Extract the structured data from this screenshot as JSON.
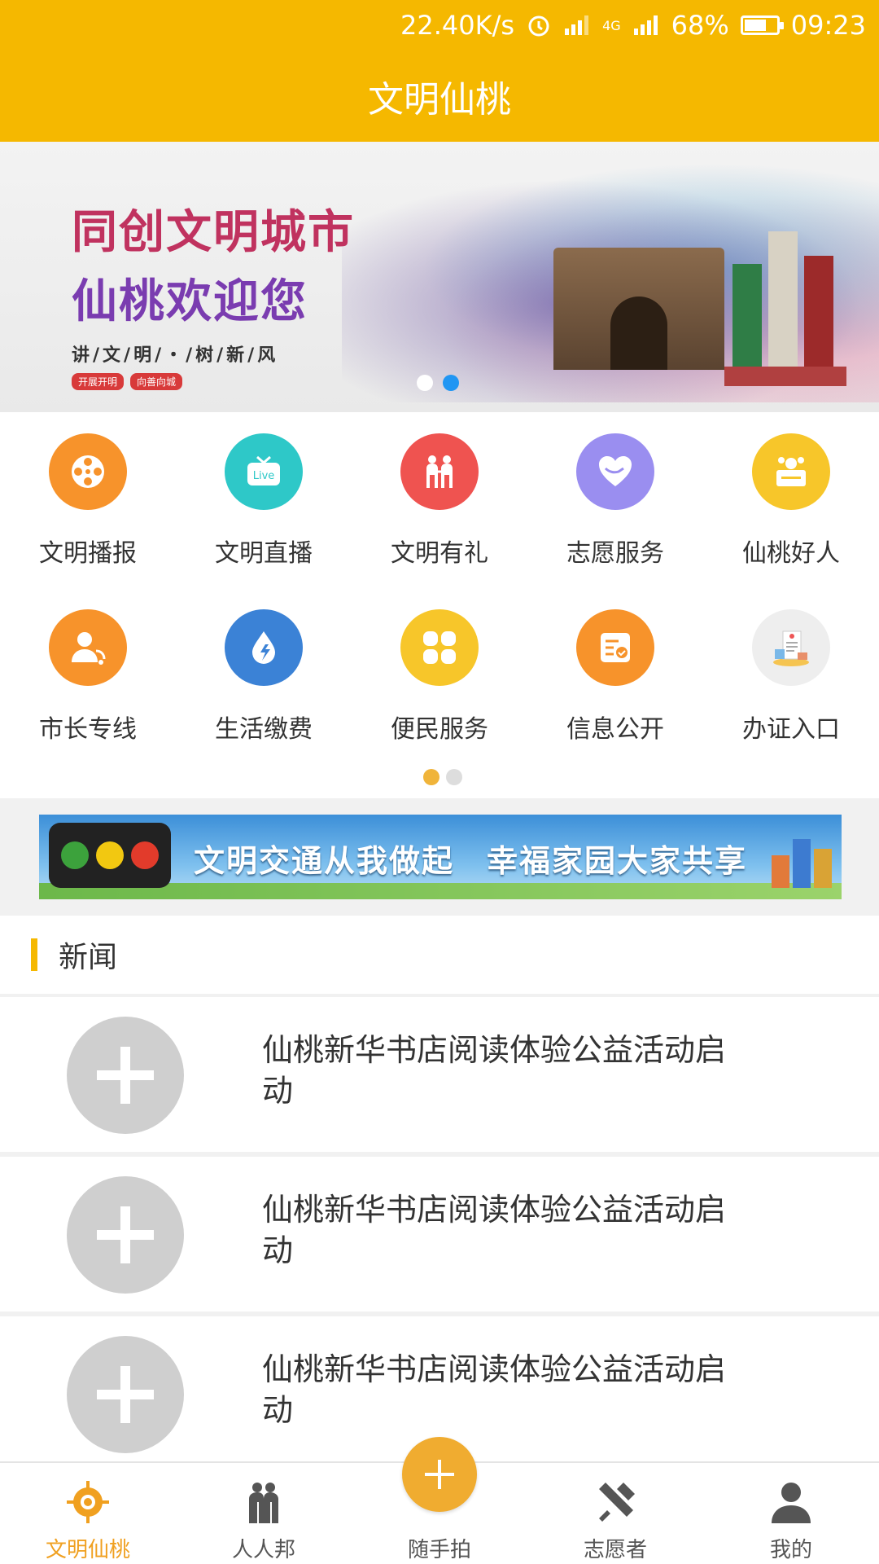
{
  "status": {
    "speed": "22.40K/s",
    "network": "4G",
    "battery": "68%",
    "battery_level": 0.68,
    "time": "09:23"
  },
  "header": {
    "title": "文明仙桃"
  },
  "banner": {
    "line1": "同创文明城市",
    "line2": "仙桃欢迎您",
    "line3": "讲/文/明/・/树/新/风",
    "tags": [
      "开展开明",
      "向善向城"
    ],
    "active_slide": 2
  },
  "grid": {
    "items": [
      {
        "label": "文明播报",
        "icon": "film-reel-icon",
        "color": "#f7932b"
      },
      {
        "label": "文明直播",
        "icon": "live-tv-icon",
        "color": "#2ec8c8"
      },
      {
        "label": "文明有礼",
        "icon": "people-icon",
        "color": "#ef5350"
      },
      {
        "label": "志愿服务",
        "icon": "heart-hand-icon",
        "color": "#9a8ef0"
      },
      {
        "label": "仙桃好人",
        "icon": "good-person-icon",
        "color": "#f7c62a"
      },
      {
        "label": "市长专线",
        "icon": "mayor-hotline-icon",
        "color": "#f7932b"
      },
      {
        "label": "生活缴费",
        "icon": "utility-drop-icon",
        "color": "#3b82d6"
      },
      {
        "label": "便民服务",
        "icon": "four-squares-icon",
        "color": "#f7c62a"
      },
      {
        "label": "信息公开",
        "icon": "document-check-icon",
        "color": "#f7932b"
      },
      {
        "label": "办证入口",
        "icon": "certificate-icon",
        "color": "#eeeeee"
      }
    ],
    "page": 1,
    "pages": 2
  },
  "traffic_banner": {
    "slogan": "文明交通从我做起　幸福家园大家共享"
  },
  "news": {
    "heading": "新闻",
    "items": [
      {
        "title": "仙桃新华书店阅读体验公益活动启动"
      },
      {
        "title": "仙桃新华书店阅读体验公益活动启动"
      },
      {
        "title": "仙桃新华书店阅读体验公益活动启动"
      }
    ]
  },
  "nav": {
    "items": [
      {
        "label": "文明仙桃",
        "icon": "target-icon",
        "active": true
      },
      {
        "label": "人人邦",
        "icon": "people-group-icon",
        "active": false
      },
      {
        "label": "随手拍",
        "icon": "plus-icon",
        "active": false
      },
      {
        "label": "志愿者",
        "icon": "tools-icon",
        "active": false
      },
      {
        "label": "我的",
        "icon": "user-icon",
        "active": false
      }
    ]
  },
  "colors": {
    "accent": "#f5b800",
    "nav_active": "#f0a020",
    "dot_active": "#2196f3"
  }
}
